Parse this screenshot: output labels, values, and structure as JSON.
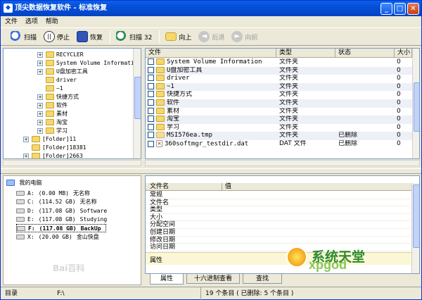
{
  "window": {
    "title": "顶尖数据恢复软件 - 标准恢复"
  },
  "menu": [
    "文件",
    "选项",
    "帮助"
  ],
  "toolbar": {
    "scan": "扫描",
    "stop": "停止",
    "recover": "恢复",
    "scan32": "扫描 32",
    "up": "向上",
    "back": "后退",
    "forward": "向前"
  },
  "tree": [
    {
      "label": "RECYCLER",
      "level": 1,
      "expander": "+"
    },
    {
      "label": "System Volume Informati",
      "level": 1,
      "expander": "+"
    },
    {
      "label": "U盘加密工具",
      "level": 1,
      "expander": "+"
    },
    {
      "label": "driver",
      "level": 1,
      "expander": ""
    },
    {
      "label": "~1",
      "level": 1,
      "expander": ""
    },
    {
      "label": "快捷方式",
      "level": 1,
      "expander": "+"
    },
    {
      "label": "软件",
      "level": 1,
      "expander": "+"
    },
    {
      "label": "素材",
      "level": 1,
      "expander": "+"
    },
    {
      "label": "淘宝",
      "level": 1,
      "expander": "+"
    },
    {
      "label": "学习",
      "level": 1,
      "expander": "+"
    },
    {
      "label": "[Folder]11",
      "level": 0,
      "expander": "+"
    },
    {
      "label": "[Folder]18381",
      "level": 0,
      "expander": ""
    },
    {
      "label": "[Folder]2663",
      "level": 0,
      "expander": "+"
    }
  ],
  "file_list": {
    "headers": [
      "文件",
      "类型",
      "状态",
      "大小"
    ],
    "rows": [
      {
        "name": "System Volume Information",
        "type": "文件夹",
        "status": "",
        "size": "0",
        "deleted": false
      },
      {
        "name": "U盘加密工具",
        "type": "文件夹",
        "status": "",
        "size": "0",
        "deleted": false
      },
      {
        "name": "driver",
        "type": "文件夹",
        "status": "",
        "size": "0",
        "deleted": false
      },
      {
        "name": "~1",
        "type": "文件夹",
        "status": "",
        "size": "0",
        "deleted": false
      },
      {
        "name": "快捷方式",
        "type": "文件夹",
        "status": "",
        "size": "0",
        "deleted": false
      },
      {
        "name": "软件",
        "type": "文件夹",
        "status": "",
        "size": "0",
        "deleted": false
      },
      {
        "name": "素材",
        "type": "文件夹",
        "status": "",
        "size": "0",
        "deleted": false
      },
      {
        "name": "淘宝",
        "type": "文件夹",
        "status": "",
        "size": "0",
        "deleted": false
      },
      {
        "name": "学习",
        "type": "文件夹",
        "status": "",
        "size": "0",
        "deleted": false
      },
      {
        "name": "MSI576ea.tmp",
        "type": "文件夹",
        "status": "已删除",
        "size": "0",
        "deleted": false
      },
      {
        "name": "360softmgr_testdir.dat",
        "type": "DAT 文件",
        "status": "已删除",
        "size": "0",
        "deleted": true
      }
    ]
  },
  "computer": {
    "root": "我的电脑",
    "drives": [
      {
        "letter": "A:",
        "size": "(0.00 MB)",
        "name": "无名称",
        "selected": false
      },
      {
        "letter": "C:",
        "size": "(114.52 GB)",
        "name": "无名称",
        "selected": false
      },
      {
        "letter": "D:",
        "size": "(117.08 GB)",
        "name": "Software",
        "selected": false
      },
      {
        "letter": "E:",
        "size": "(117.08 GB)",
        "name": "Studying",
        "selected": false
      },
      {
        "letter": "F:",
        "size": "(117.08 GB)",
        "name": "BackUp",
        "selected": true
      },
      {
        "letter": "X:",
        "size": "(20.00 GB)",
        "name": "金山快盘",
        "selected": false
      }
    ]
  },
  "properties": {
    "headers": [
      "文件名",
      "值"
    ],
    "rows": [
      "常规",
      "文件名",
      "类型",
      "大小",
      "分配空间",
      "创建日期",
      "修改日期",
      "访问日期"
    ],
    "footer": "属性"
  },
  "tabs": [
    "属性",
    "十六进制查看",
    "查找"
  ],
  "status": {
    "label": "目录",
    "path": "F:\\",
    "count": "19 个条目 ( 已删除: 5 个条目 )"
  },
  "watermark": {
    "brand_cn": "系统天堂",
    "brand_en": "xpgod",
    "baidu": "Bai百科"
  }
}
